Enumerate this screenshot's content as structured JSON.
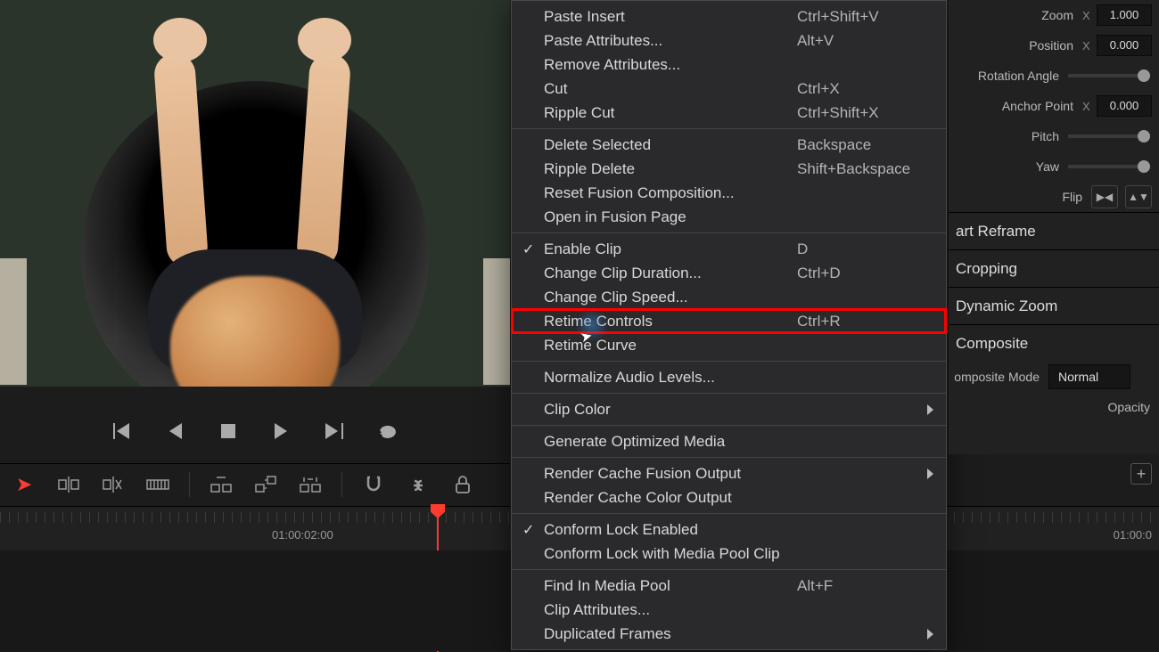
{
  "viewer": {
    "title": "video-preview"
  },
  "playback": {
    "first": "first-frame",
    "prev": "prev-frame",
    "stop": "stop",
    "play": "play",
    "next": "next-frame",
    "loop": "loop"
  },
  "toolbar": {
    "arrow": "selection",
    "t1": "insert-clip",
    "t2": "overwrite-clip",
    "t3": "replace-clip",
    "t4": "blade",
    "t5": "swap",
    "t6": "ripple",
    "snap": "snap",
    "link": "link",
    "lock": "lock"
  },
  "timeline": {
    "timecode1": "01:00:02:00",
    "timecode2": "01:00:0"
  },
  "ctx": [
    {
      "label": "Paste Insert",
      "shortcut": "Ctrl+Shift+V"
    },
    {
      "label": "Paste Attributes...",
      "shortcut": "Alt+V"
    },
    {
      "label": "Remove Attributes..."
    },
    {
      "label": "Cut",
      "shortcut": "Ctrl+X"
    },
    {
      "label": "Ripple Cut",
      "shortcut": "Ctrl+Shift+X"
    },
    {
      "sep": true
    },
    {
      "label": "Delete Selected",
      "shortcut": "Backspace"
    },
    {
      "label": "Ripple Delete",
      "shortcut": "Shift+Backspace"
    },
    {
      "label": "Reset Fusion Composition..."
    },
    {
      "label": "Open in Fusion Page"
    },
    {
      "sep": true
    },
    {
      "label": "Enable Clip",
      "shortcut": "D",
      "check": true
    },
    {
      "label": "Change Clip Duration...",
      "shortcut": "Ctrl+D"
    },
    {
      "label": "Change Clip Speed..."
    },
    {
      "label": "Retime Controls",
      "shortcut": "Ctrl+R",
      "hl": true
    },
    {
      "label": "Retime Curve"
    },
    {
      "sep": true
    },
    {
      "label": "Normalize Audio Levels..."
    },
    {
      "sep": true
    },
    {
      "label": "Clip Color",
      "sub": true
    },
    {
      "sep": true
    },
    {
      "label": "Generate Optimized Media"
    },
    {
      "sep": true
    },
    {
      "label": "Render Cache Fusion Output",
      "sub": true
    },
    {
      "label": "Render Cache Color Output"
    },
    {
      "sep": true
    },
    {
      "label": "Conform Lock Enabled",
      "check": true
    },
    {
      "label": "Conform Lock with Media Pool Clip"
    },
    {
      "sep": true
    },
    {
      "label": "Find In Media Pool",
      "shortcut": "Alt+F"
    },
    {
      "label": "Clip Attributes..."
    },
    {
      "label": "Duplicated Frames",
      "sub": true
    }
  ],
  "inspector": {
    "zoom_label": "Zoom",
    "zoom_axis": "X",
    "zoom_val": "1.000",
    "pos_label": "Position",
    "pos_axis": "X",
    "pos_val": "0.000",
    "rot_label": "Rotation Angle",
    "anchor_label": "Anchor Point",
    "anchor_axis": "X",
    "anchor_val": "0.000",
    "pitch_label": "Pitch",
    "yaw_label": "Yaw",
    "flip_label": "Flip",
    "sect_reframe": "art Reframe",
    "sect_crop": "Cropping",
    "sect_dzoom": "Dynamic Zoom",
    "sect_comp": "Composite",
    "comp_mode_label": "omposite Mode",
    "comp_mode_val": "Normal",
    "opacity_label": "Opacity"
  }
}
